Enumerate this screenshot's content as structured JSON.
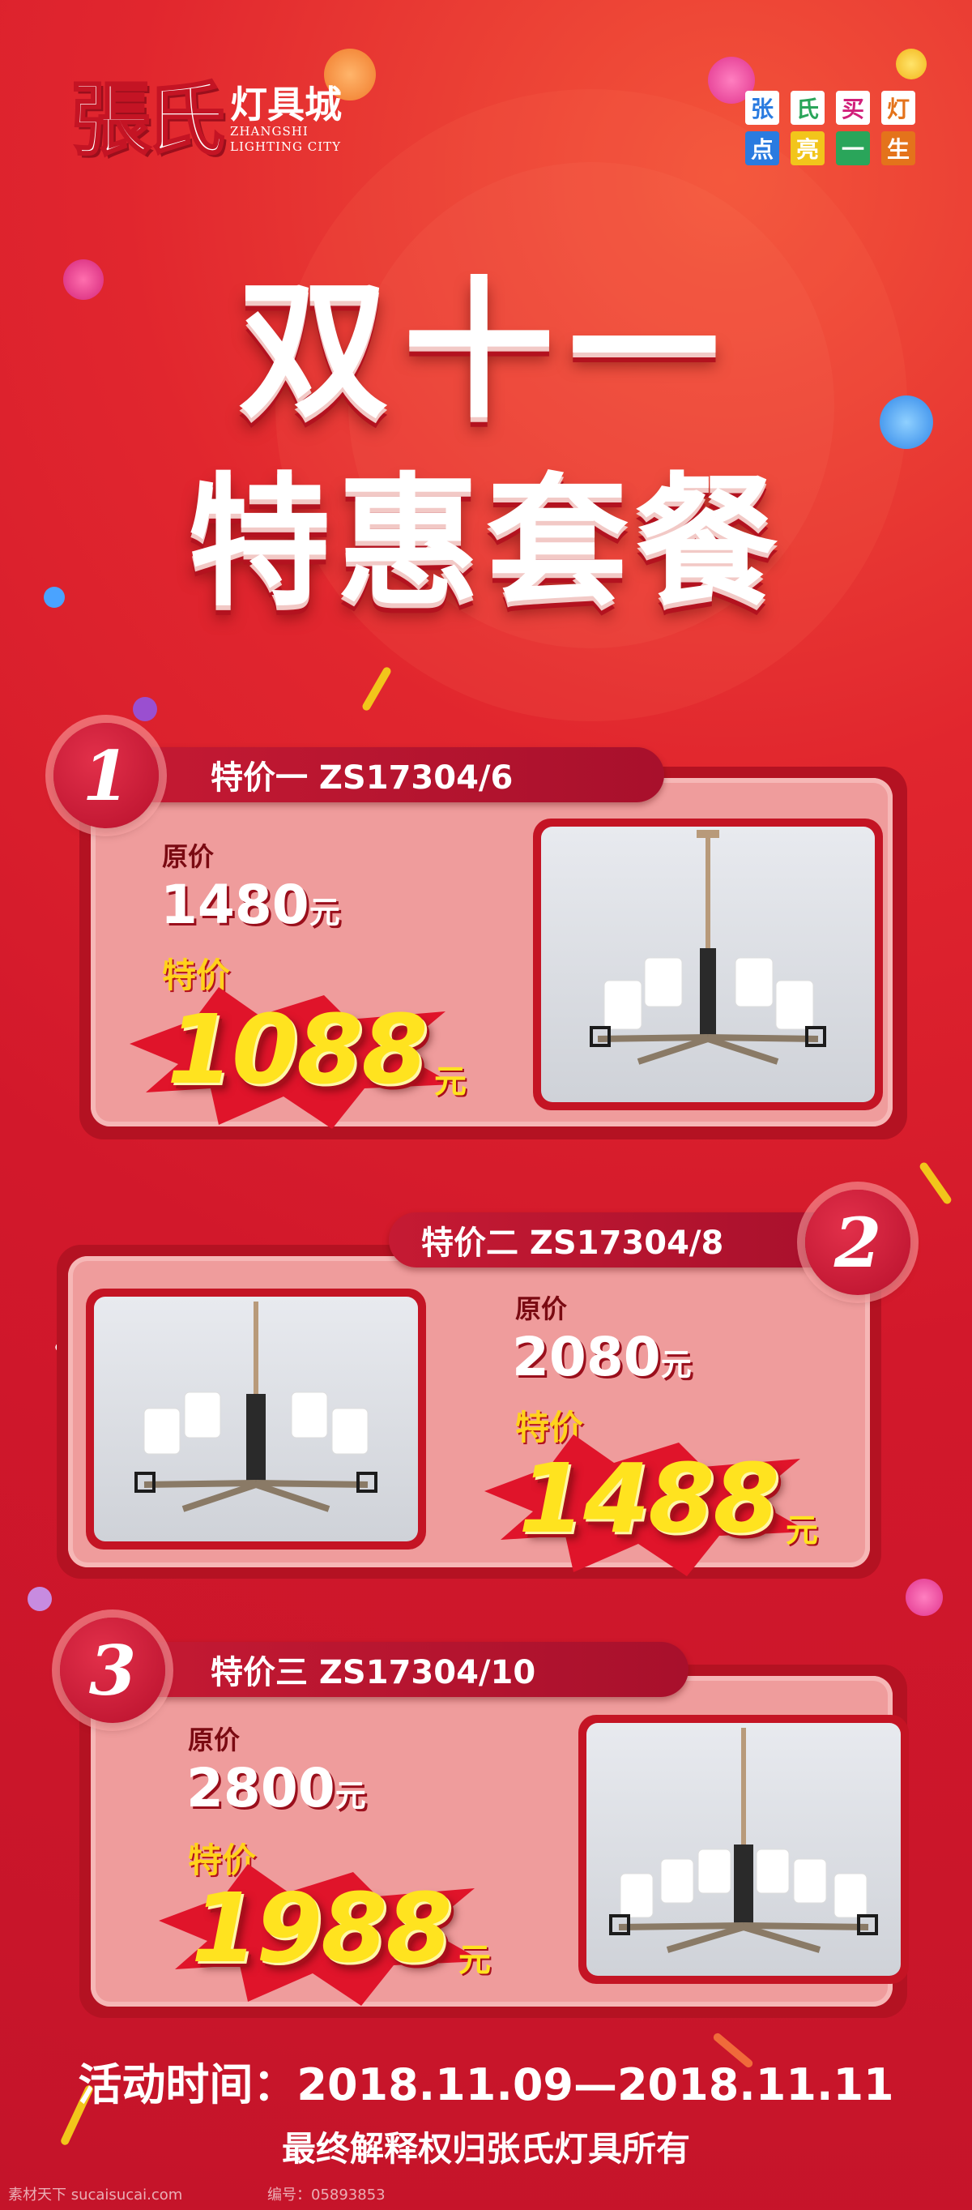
{
  "header": {
    "logo_mark": "張氏",
    "logo_cn": "灯具城",
    "logo_en_line1": "ZHANGSHI",
    "logo_en_line2": "LIGHTING CITY",
    "slogan": [
      "张",
      "氏",
      "买",
      "灯",
      "点",
      "亮",
      "一",
      "生"
    ]
  },
  "title": {
    "line1": "双十一",
    "line2": "特惠套餐"
  },
  "offers": [
    {
      "number": "1",
      "name": "特价一  ZS17304/6",
      "original_label": "原价",
      "original_price": "1480",
      "original_unit": "元",
      "special_label": "特价",
      "special_price": "1088",
      "special_unit": "元"
    },
    {
      "number": "2",
      "name": "特价二  ZS17304/8",
      "original_label": "原价",
      "original_price": "2080",
      "original_unit": "元",
      "special_label": "特价",
      "special_price": "1488",
      "special_unit": "元"
    },
    {
      "number": "3",
      "name": "特价三  ZS17304/10",
      "original_label": "原价",
      "original_price": "2800",
      "original_unit": "元",
      "special_label": "特价",
      "special_price": "1988",
      "special_unit": "元"
    }
  ],
  "footer": {
    "activity_time": "活动时间：2018.11.09—2018.11.11",
    "rights": "最终解释权归张氏灯具所有"
  },
  "watermark": {
    "site": "素材天下 sucaisucai.com",
    "id": "编号：05893853"
  },
  "colors": {
    "background": "#d2182b",
    "card": "#ef9c9c",
    "price": "#ffe31f",
    "pill": "#b8102c"
  }
}
